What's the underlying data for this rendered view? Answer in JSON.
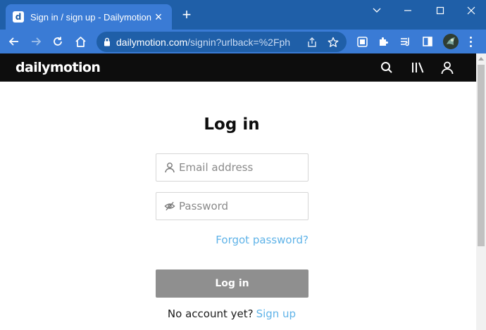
{
  "browser": {
    "tab": {
      "favicon_letter": "d",
      "title": "Sign in / sign up - Dailymotion"
    },
    "address": {
      "host": "dailymotion.com",
      "path": "/signin?urlback=%2Fph"
    }
  },
  "site": {
    "logo_text": "dailymotion"
  },
  "login": {
    "heading": "Log in",
    "email_placeholder": "Email address",
    "password_placeholder": "Password",
    "forgot_label": "Forgot password?",
    "login_label": "Log in",
    "no_account_text": "No account yet?",
    "signup_label": "Sign up"
  },
  "colors": {
    "chrome_dark": "#1f5fa8",
    "chrome_light": "#3a7bd5",
    "site_header": "#0d0d0d",
    "link": "#5fb3e8",
    "disabled_button": "#8f8f8f"
  },
  "icons": {
    "tab_close": "close-icon",
    "new_tab": "plus-icon",
    "back": "arrow-left-icon",
    "forward": "arrow-right-icon",
    "reload": "reload-icon",
    "home": "home-icon",
    "lock": "lock-icon",
    "share": "share-icon",
    "bookmark": "star-icon",
    "search": "search-icon",
    "library": "library-icon",
    "user": "user-icon",
    "eye_off": "eye-off-icon"
  }
}
